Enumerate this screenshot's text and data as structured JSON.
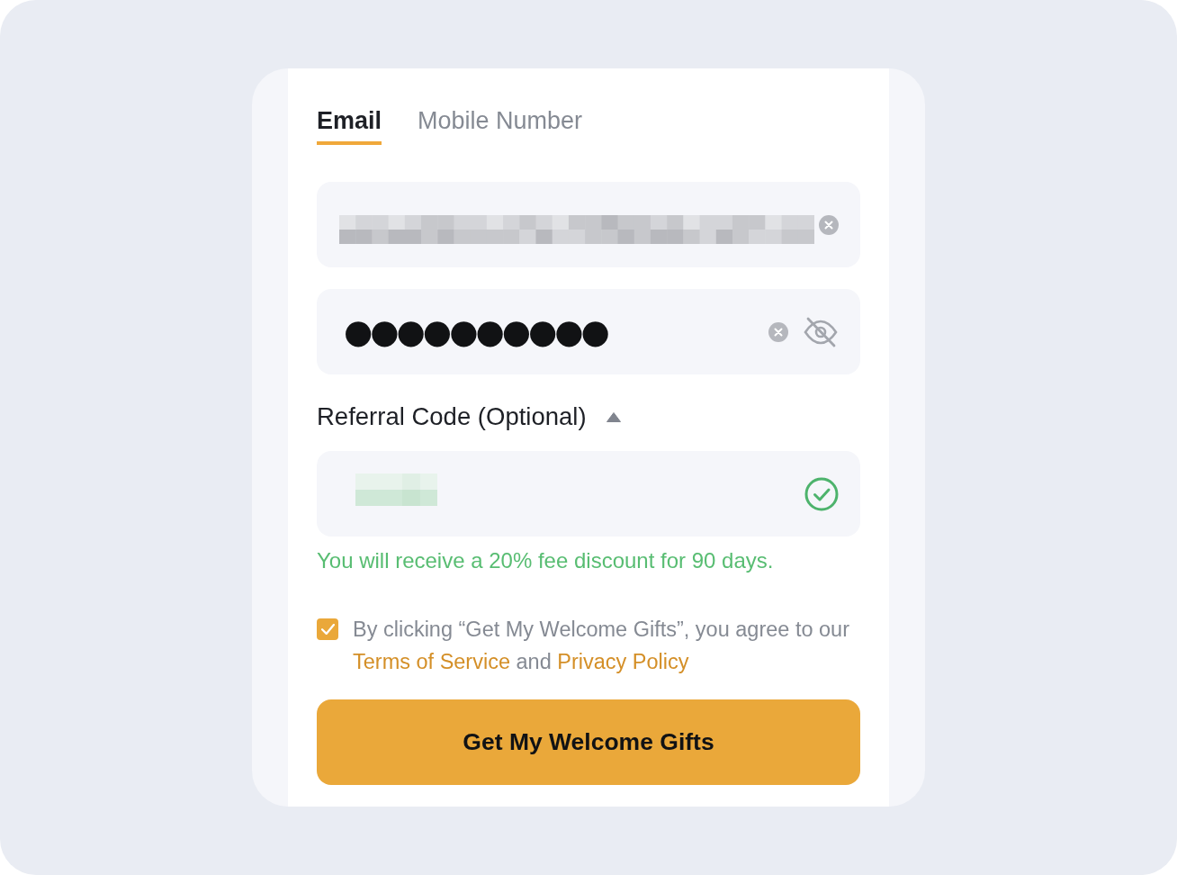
{
  "tabs": [
    {
      "label": "Email",
      "selected": true
    },
    {
      "label": "Mobile Number",
      "selected": false
    }
  ],
  "fields": [
    {
      "kind": "email",
      "value_redacted": true,
      "clear_button": true
    },
    {
      "kind": "password",
      "masked_value": "●●●●●●●●●●",
      "clear_button": true,
      "password_visible": false
    }
  ],
  "referral": {
    "label": "Referral Code (Optional)",
    "expanded": true,
    "value_redacted": true,
    "valid": true,
    "message": "You will receive a 20% fee discount for 90 days."
  },
  "agreement": {
    "checked": true,
    "parts": [
      {
        "kind": "text",
        "text": "By clicking “Get My Welcome Gifts”, you agree to our"
      },
      {
        "kind": "link",
        "text": "Terms of Service"
      },
      {
        "kind": "text",
        "text": "and"
      },
      {
        "kind": "link",
        "text": "Privacy Policy"
      }
    ]
  },
  "submit_button": {
    "label": "Get My Welcome Gifts"
  }
}
